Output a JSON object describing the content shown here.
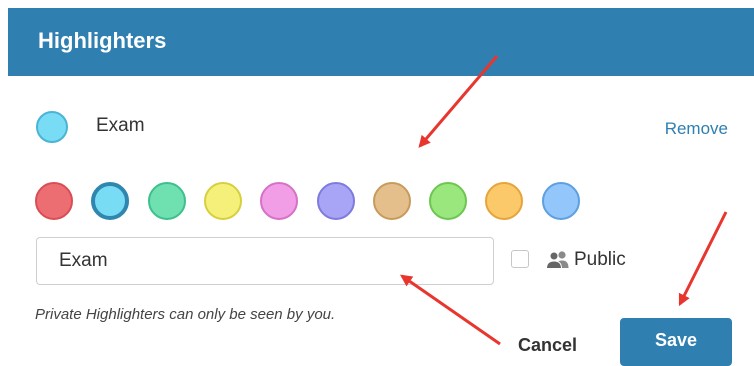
{
  "dialog": {
    "title": "Highlighters"
  },
  "current": {
    "label": "Exam",
    "color": "#79dcf5",
    "border": "#4ab3d6"
  },
  "remove_label": "Remove",
  "palette": [
    {
      "name": "red",
      "fill": "#ec6e72",
      "border": "#d94e55"
    },
    {
      "name": "cyan",
      "fill": "#79dcf5",
      "border": "#2f87b0",
      "selected": true
    },
    {
      "name": "teal",
      "fill": "#6fe0b0",
      "border": "#3fbf8d"
    },
    {
      "name": "yellow",
      "fill": "#f5f07a",
      "border": "#d6cf3e"
    },
    {
      "name": "pink",
      "fill": "#f19ee6",
      "border": "#d571c7"
    },
    {
      "name": "purple",
      "fill": "#a8a5f7",
      "border": "#7f7bdc"
    },
    {
      "name": "tan",
      "fill": "#e4bf8c",
      "border": "#c79b5c"
    },
    {
      "name": "green",
      "fill": "#9ae77d",
      "border": "#6ec652"
    },
    {
      "name": "orange",
      "fill": "#fbc86a",
      "border": "#e6a53a"
    },
    {
      "name": "blue",
      "fill": "#93c7fb",
      "border": "#5e9fe0"
    }
  ],
  "name_field": {
    "value": "Exam"
  },
  "public": {
    "label": "Public",
    "checked": false,
    "icon": "people-icon"
  },
  "hint": "Private Highlighters can only be seen by you.",
  "buttons": {
    "cancel": "Cancel",
    "save": "Save"
  },
  "colors": {
    "header": "#2f7fb1",
    "accent": "#2f7fb1",
    "annotation": "#e8362f"
  }
}
